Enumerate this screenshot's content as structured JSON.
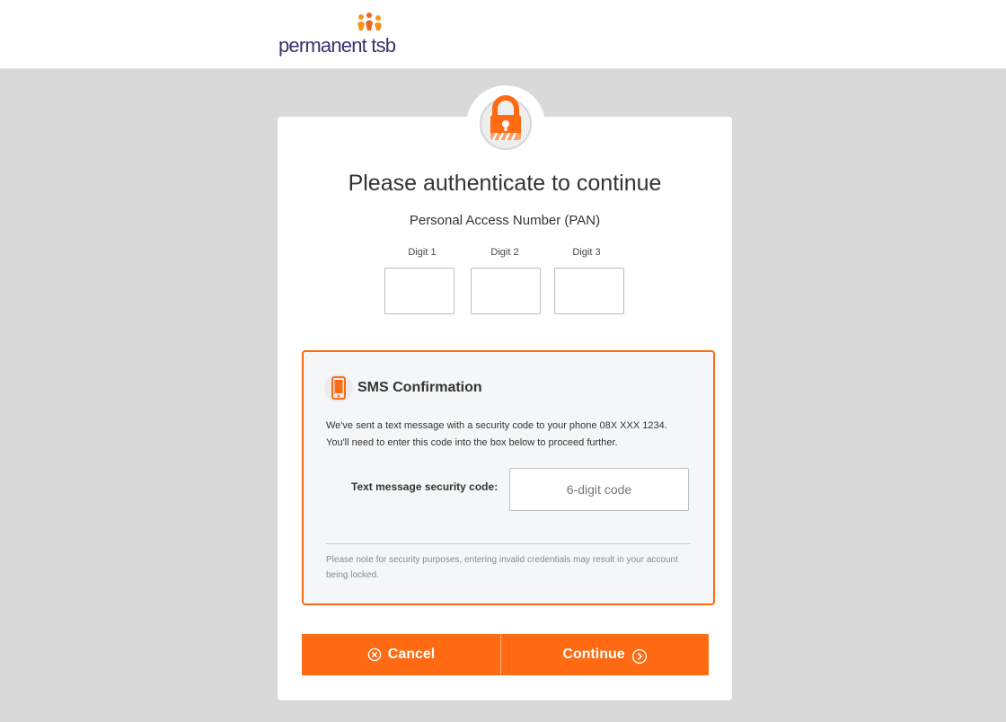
{
  "header": {
    "logo_text": "permanent tsb"
  },
  "auth": {
    "title": "Please authenticate to continue",
    "pan_label": "Personal Access Number (PAN)",
    "digits": [
      {
        "label": "Digit 1",
        "value": ""
      },
      {
        "label": "Digit 2",
        "value": ""
      },
      {
        "label": "Digit 3",
        "value": ""
      }
    ]
  },
  "sms": {
    "title": "SMS Confirmation",
    "message_line1": "We've sent a text message with a security code to your phone 08X XXX 1234.",
    "message_line2": "You'll need to enter this code into the box below to proceed further.",
    "code_label": "Text message security code:",
    "code_placeholder": "6-digit code",
    "code_value": "",
    "note": "Please note for security purposes, entering invalid credentials may result in your account being locked."
  },
  "buttons": {
    "cancel_label": "Cancel",
    "continue_label": "Continue"
  },
  "icons": {
    "logo": "people-logo-icon",
    "lock": "padlock-icon",
    "phone": "mobile-phone-icon",
    "cancel": "circle-x-icon",
    "continue": "circle-chevron-right-icon"
  },
  "colors": {
    "accent": "#ff6a13",
    "brand_text": "#3d2f70",
    "background": "#d9d9d9"
  }
}
